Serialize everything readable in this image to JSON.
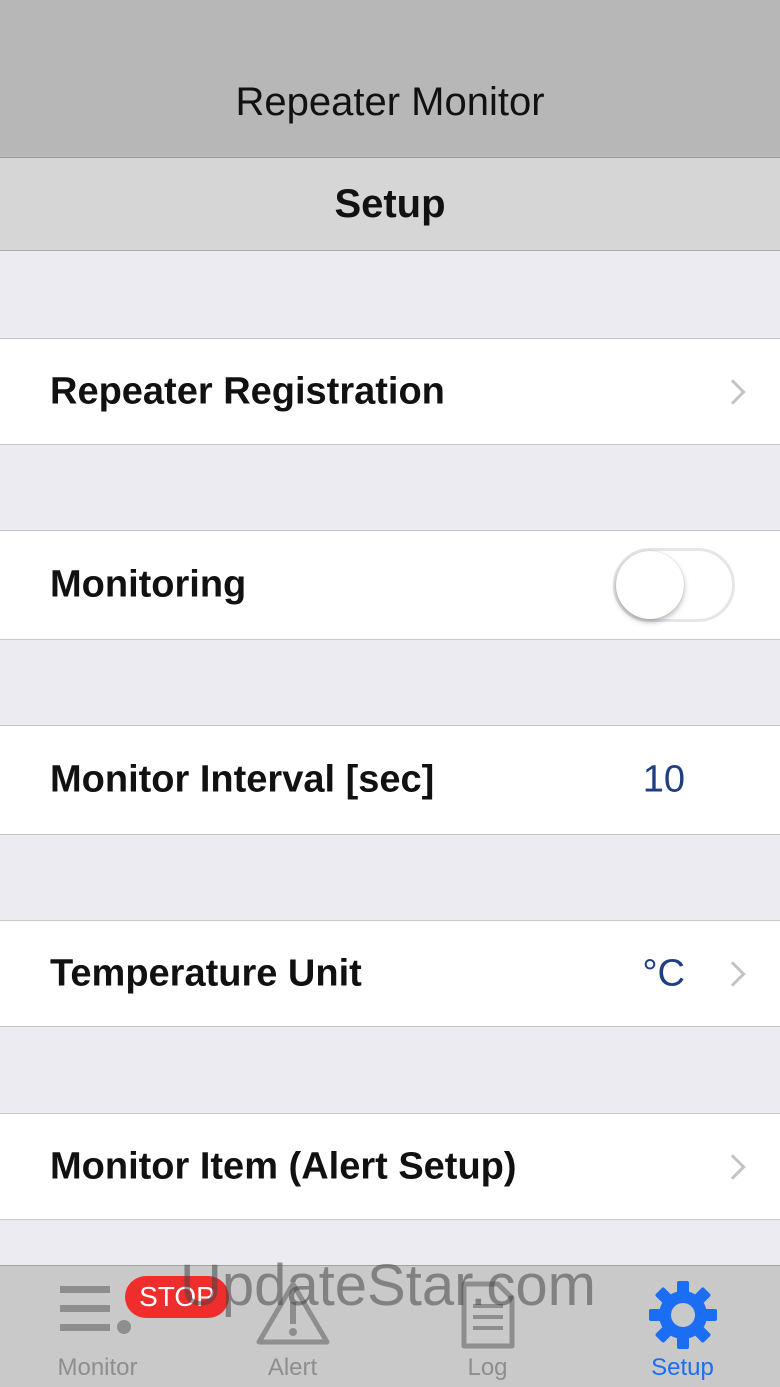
{
  "header": {
    "title": "Repeater Monitor"
  },
  "subheader": {
    "title": "Setup"
  },
  "rows": {
    "repeater_registration": {
      "label": "Repeater Registration"
    },
    "monitoring": {
      "label": "Monitoring",
      "enabled": false
    },
    "monitor_interval": {
      "label": "Monitor Interval [sec]",
      "value": "10"
    },
    "temperature_unit": {
      "label": "Temperature Unit",
      "value": "°C"
    },
    "monitor_item": {
      "label": "Monitor Item (Alert Setup)"
    }
  },
  "tabbar": {
    "active": "Setup",
    "accent_color": "#1b6ef3",
    "inactive_color": "#8e8e8e",
    "stop_badge": "STOP",
    "tabs": [
      {
        "label": "Monitor",
        "icon": "monitor-list-icon"
      },
      {
        "label": "Alert",
        "icon": "alert-triangle-icon"
      },
      {
        "label": "Log",
        "icon": "log-document-icon"
      },
      {
        "label": "Setup",
        "icon": "gear-icon"
      }
    ]
  },
  "watermark": "UpdateStar.com"
}
